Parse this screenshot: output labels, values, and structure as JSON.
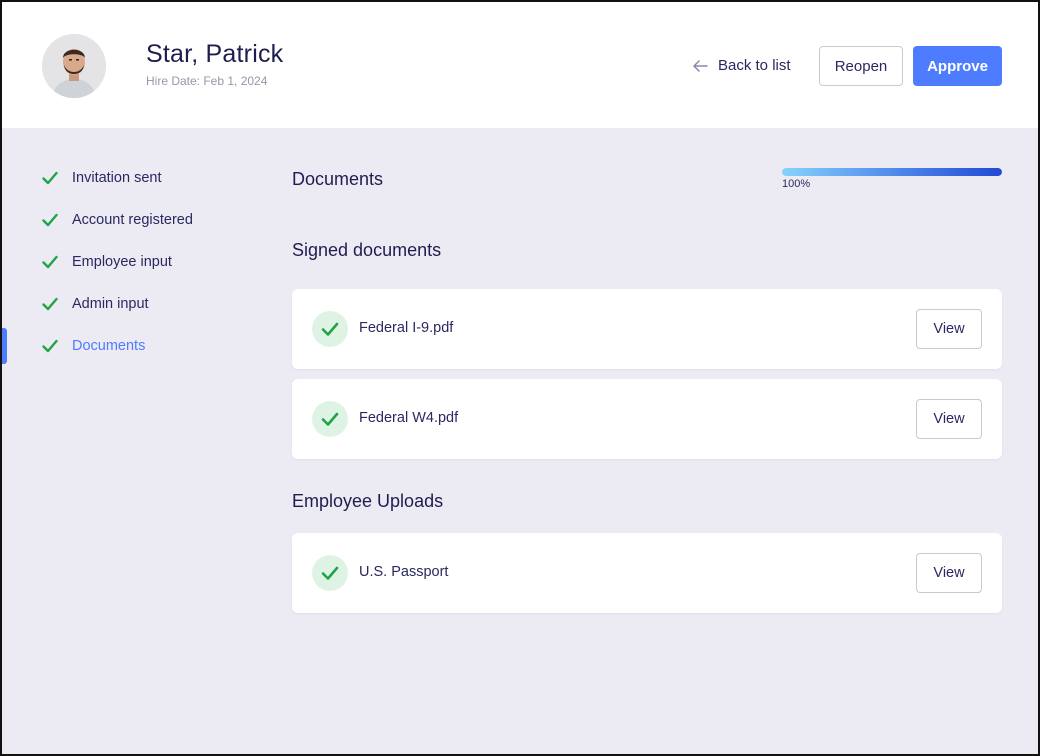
{
  "colors": {
    "accent": "#4d7cfe",
    "check_green": "#1fa447",
    "badge_bg": "#dff3e4",
    "page_bg": "#ecebf4",
    "text_dark": "#1f1d4f"
  },
  "header": {
    "avatar_icon": "person-avatar",
    "name": "Star, Patrick",
    "hire_date": "Hire Date: Feb 1, 2024",
    "back_icon": "arrow-left-icon",
    "back_label": "Back to list",
    "reopen_label": "Reopen",
    "approve_label": "Approve"
  },
  "sidebar": {
    "items": [
      {
        "label": "Invitation sent",
        "icon": "check-icon",
        "active": false
      },
      {
        "label": "Account registered",
        "icon": "check-icon",
        "active": false
      },
      {
        "label": "Employee input",
        "icon": "check-icon",
        "active": false
      },
      {
        "label": "Admin input",
        "icon": "check-icon",
        "active": false
      },
      {
        "label": "Documents",
        "icon": "check-icon",
        "active": true
      }
    ]
  },
  "main": {
    "title": "Documents",
    "progress": {
      "value_percent": 100,
      "label": "100%"
    },
    "sections": [
      {
        "title": "Signed documents",
        "documents": [
          {
            "name": "Federal I-9.pdf",
            "status_icon": "check-icon",
            "action_label": "View"
          },
          {
            "name": "Federal W4.pdf",
            "status_icon": "check-icon",
            "action_label": "View"
          }
        ]
      },
      {
        "title": "Employee Uploads",
        "documents": [
          {
            "name": "U.S. Passport",
            "status_icon": "check-icon",
            "action_label": "View"
          }
        ]
      }
    ]
  }
}
